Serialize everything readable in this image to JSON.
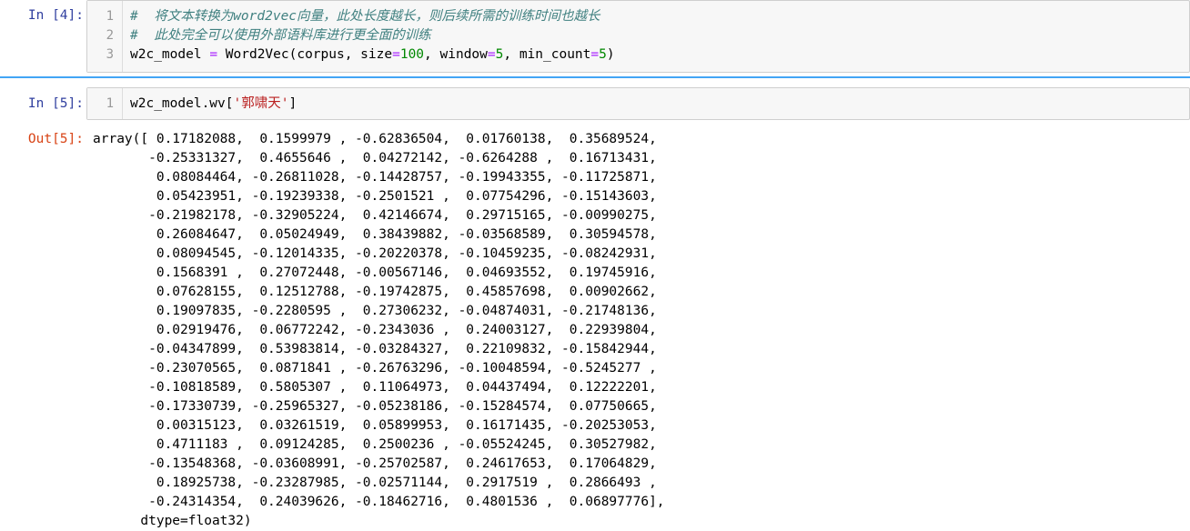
{
  "cells": [
    {
      "prompt": "In  [4]:",
      "line_numbers": [
        "1",
        "2",
        "3"
      ],
      "lines": [
        "#  将文本转换为word2vec向量，此处长度越长，则后续所需的训练时间也越长",
        "#  此处完全可以使用外部语料库进行更全面的训练",
        "w2c_model = Word2Vec(corpus, size=100, window=5, min_count=5)"
      ]
    },
    {
      "prompt": "In  [5]:",
      "line_numbers": [
        "1"
      ],
      "lines": [
        "w2c_model.wv['郭啸天']"
      ],
      "output_prompt": "Out[5]:",
      "output_lines": [
        "array([ 0.17182088,  0.1599979 , -0.62836504,  0.01760138,  0.35689524,",
        "       -0.25331327,  0.4655646 ,  0.04272142, -0.6264288 ,  0.16713431,",
        "        0.08084464, -0.26811028, -0.14428757, -0.19943355, -0.11725871,",
        "        0.05423951, -0.19239338, -0.2501521 ,  0.07754296, -0.15143603,",
        "       -0.21982178, -0.32905224,  0.42146674,  0.29715165, -0.00990275,",
        "        0.26084647,  0.05024949,  0.38439882, -0.03568589,  0.30594578,",
        "        0.08094545, -0.12014335, -0.20220378, -0.10459235, -0.08242931,",
        "        0.1568391 ,  0.27072448, -0.00567146,  0.04693552,  0.19745916,",
        "        0.07628155,  0.12512788, -0.19742875,  0.45857698,  0.00902662,",
        "        0.19097835, -0.2280595 ,  0.27306232, -0.04874031, -0.21748136,",
        "        0.02919476,  0.06772242, -0.2343036 ,  0.24003127,  0.22939804,",
        "       -0.04347899,  0.53983814, -0.03284327,  0.22109832, -0.15842944,",
        "       -0.23070565,  0.0871841 , -0.26763296, -0.10048594, -0.5245277 ,",
        "       -0.10818589,  0.5805307 ,  0.11064973,  0.04437494,  0.12222201,",
        "       -0.17330739, -0.25965327, -0.05238186, -0.15284574,  0.07750665,",
        "        0.00315123,  0.03261519,  0.05899953,  0.16171435, -0.20253053,",
        "        0.4711183 ,  0.09124285,  0.2500236 , -0.05524245,  0.30527982,",
        "       -0.13548368, -0.03608991, -0.25702587,  0.24617653,  0.17064829,",
        "        0.18925738, -0.23287985, -0.02571144,  0.2917519 ,  0.2866493 ,",
        "       -0.24314354,  0.24039626, -0.18462716,  0.4801536 ,  0.06897776],",
        "      dtype=float32)"
      ]
    }
  ],
  "colors": {
    "prompt_in": "#303f9f",
    "prompt_out": "#d84315",
    "comment": "#408080",
    "string": "#ba2121",
    "number": "#008800",
    "operator": "#aa22ff",
    "cell_selected_border": "#42a5f5"
  }
}
